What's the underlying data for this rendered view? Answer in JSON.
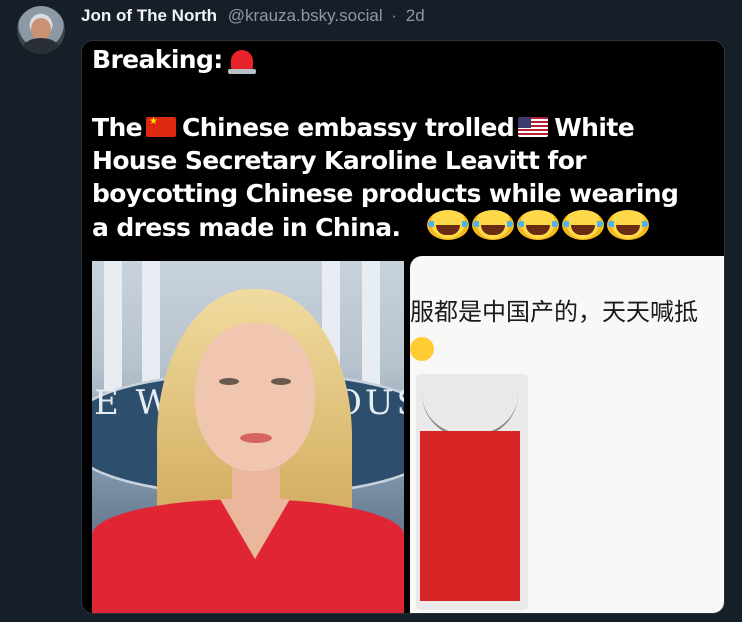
{
  "post": {
    "author_name": "Jon of The North",
    "handle": "@krauza.bsky.social",
    "separator": "·",
    "time": "2d"
  },
  "card": {
    "line1": "Breaking:",
    "line2_a": "The",
    "line2_b": "Chinese embassy trolled",
    "line2_c": "White",
    "line3": "House Secretary Karoline Leavitt for",
    "line4": "boycotting Chinese products while wearing",
    "line5": "a dress made in China.",
    "image_left_sign": "E W",
    "image_left_sign2": "OUS",
    "image_right_caption": "服都是中国产的，天天喊抵"
  },
  "icons": {
    "siren": "police-siren-icon",
    "flag_cn": "china-flag-icon",
    "flag_us": "us-flag-icon",
    "laugh": "tears-of-joy-icon"
  }
}
